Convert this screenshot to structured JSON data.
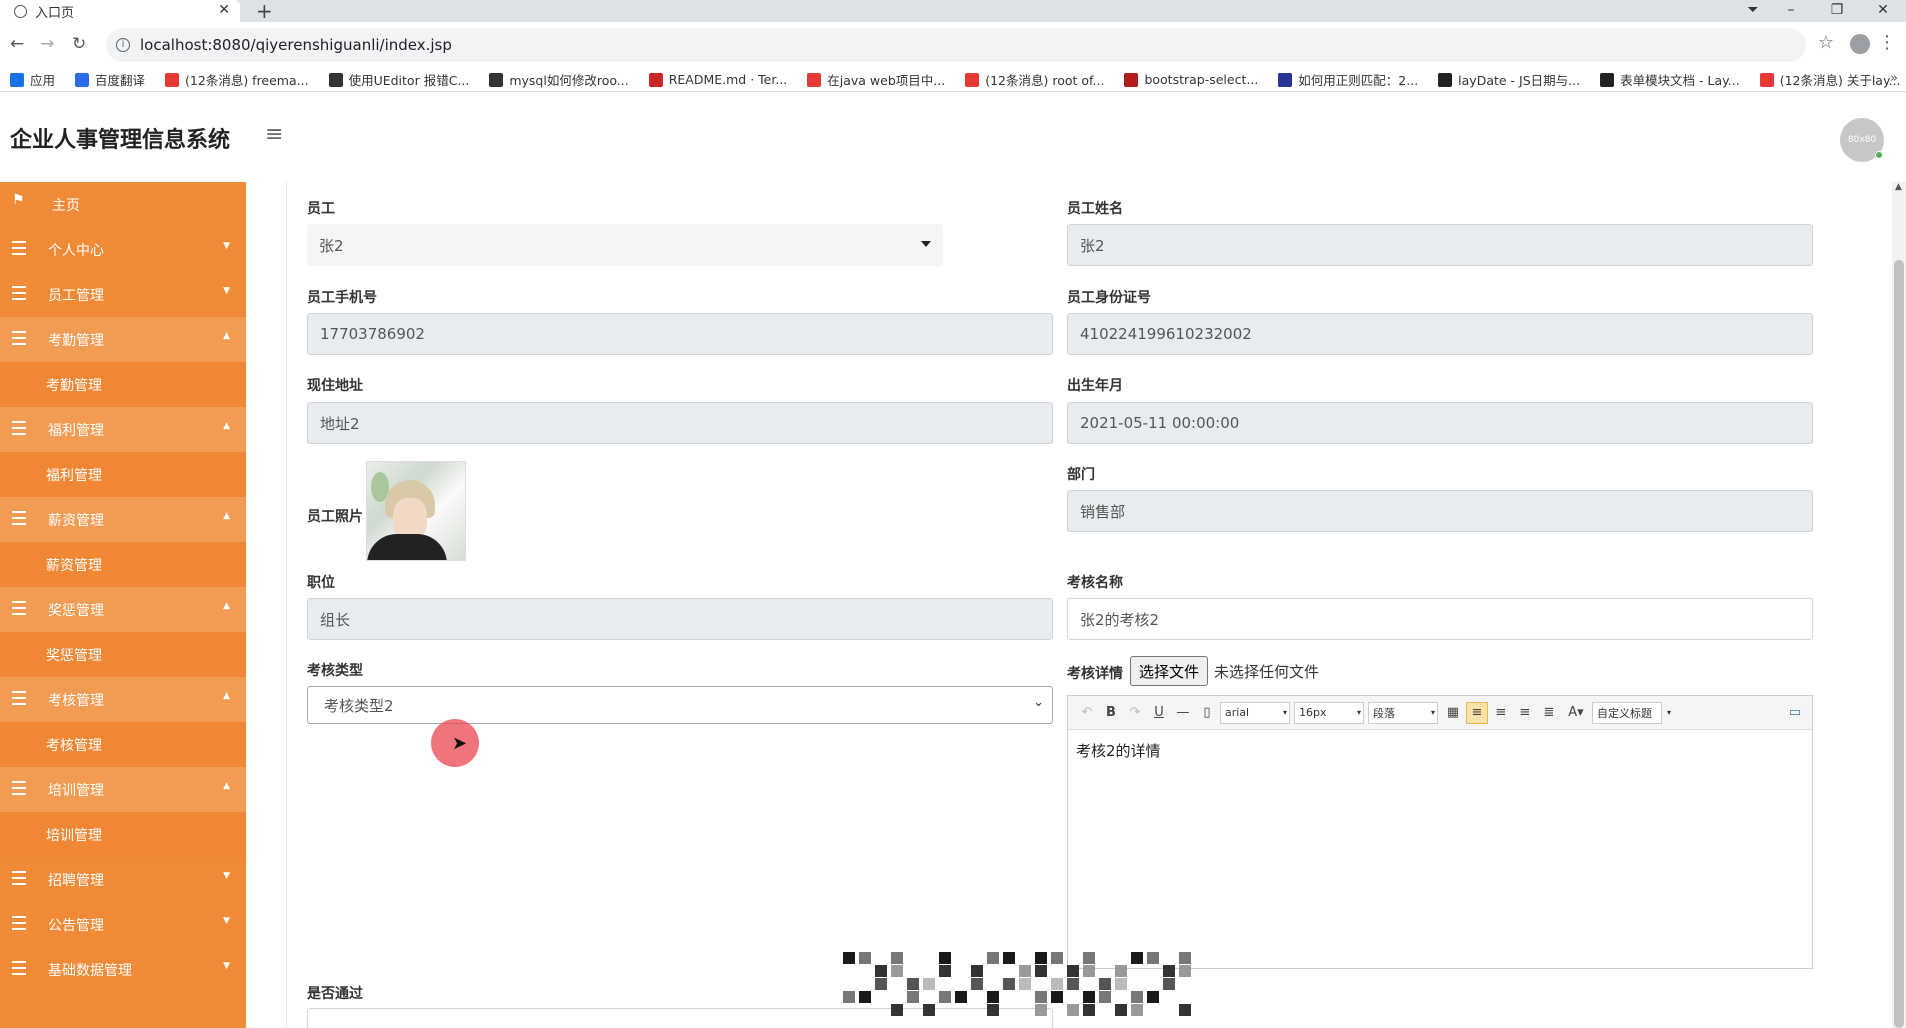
{
  "browser": {
    "tab_title": "入口页",
    "url": "localhost:8080/qiyerenshiguanli/index.jsp",
    "bookmarks": [
      {
        "label": "应用",
        "color": "#1a73e8"
      },
      {
        "label": "百度翻译",
        "color": "#2b6de8"
      },
      {
        "label": "(12条消息) freema...",
        "color": "#e53935"
      },
      {
        "label": "使用UEditor 报错C...",
        "color": "#333333"
      },
      {
        "label": "mysql如何修改roo...",
        "color": "#333333"
      },
      {
        "label": "README.md · Ter...",
        "color": "#c62828"
      },
      {
        "label": "在java web项目中...",
        "color": "#e53935"
      },
      {
        "label": "(12条消息) root of...",
        "color": "#e53935"
      },
      {
        "label": "bootstrap-select...",
        "color": "#b71c1c"
      },
      {
        "label": "如何用正则匹配：2...",
        "color": "#283593"
      },
      {
        "label": "layDate - JS日期与...",
        "color": "#222222"
      },
      {
        "label": "表单模块文档 - Lay...",
        "color": "#222222"
      },
      {
        "label": "(12条消息) 关于lay...",
        "color": "#e53935"
      }
    ]
  },
  "app": {
    "title": "企业人事管理信息系统",
    "avatar_text": "80x80"
  },
  "sidebar": {
    "items": [
      {
        "label": "主页",
        "icon": "flag-icon",
        "arrow": "",
        "open": false,
        "sub": ""
      },
      {
        "label": "个人中心",
        "icon": "grid-icon",
        "arrow": "▼",
        "open": false,
        "sub": ""
      },
      {
        "label": "员工管理",
        "icon": "grid-icon",
        "arrow": "▼",
        "open": false,
        "sub": ""
      },
      {
        "label": "考勤管理",
        "icon": "grid-icon",
        "arrow": "▲",
        "open": true,
        "sub": "考勤管理"
      },
      {
        "label": "福利管理",
        "icon": "grid-icon",
        "arrow": "▲",
        "open": true,
        "sub": "福利管理"
      },
      {
        "label": "薪资管理",
        "icon": "grid-icon",
        "arrow": "▲",
        "open": true,
        "sub": "薪资管理"
      },
      {
        "label": "奖惩管理",
        "icon": "grid-icon",
        "arrow": "▲",
        "open": true,
        "sub": "奖惩管理"
      },
      {
        "label": "考核管理",
        "icon": "grid-icon",
        "arrow": "▲",
        "open": true,
        "sub": "考核管理"
      },
      {
        "label": "培训管理",
        "icon": "grid-icon",
        "arrow": "▲",
        "open": true,
        "sub": "培训管理"
      },
      {
        "label": "招聘管理",
        "icon": "grid-icon",
        "arrow": "▼",
        "open": false,
        "sub": ""
      },
      {
        "label": "公告管理",
        "icon": "grid-icon",
        "arrow": "▼",
        "open": false,
        "sub": ""
      },
      {
        "label": "基础数据管理",
        "icon": "grid-icon",
        "arrow": "▼",
        "open": false,
        "sub": ""
      }
    ]
  },
  "form": {
    "employee": {
      "label": "员工",
      "value": "张2"
    },
    "employee_name": {
      "label": "员工姓名",
      "value": "张2"
    },
    "phone": {
      "label": "员工手机号",
      "value": "17703786902"
    },
    "id_number": {
      "label": "员工身份证号",
      "value": "410224199610232002"
    },
    "address": {
      "label": "现住地址",
      "value": "地址2"
    },
    "birth": {
      "label": "出生年月",
      "value": "2021-05-11 00:00:00"
    },
    "photo": {
      "label": "员工照片"
    },
    "department": {
      "label": "部门",
      "value": "销售部"
    },
    "position": {
      "label": "职位",
      "value": "组长"
    },
    "assessment_name": {
      "label": "考核名称",
      "value": "张2的考核2"
    },
    "assessment_type": {
      "label": "考核类型",
      "value": "考核类型2"
    },
    "assessment_detail": {
      "label": "考核详情",
      "file_button": "选择文件",
      "file_status": "未选择任何文件",
      "editor_font": "arial",
      "editor_size": "16px",
      "editor_para": "段落",
      "editor_custom": "自定义标题",
      "content": "考核2的详情"
    },
    "passed": {
      "label": "是否通过"
    }
  },
  "colors": {
    "sidebar_bg": "#f08a37",
    "sidebar_open_bg": "#f29b52",
    "input_readonly_bg": "#e9ecef"
  }
}
